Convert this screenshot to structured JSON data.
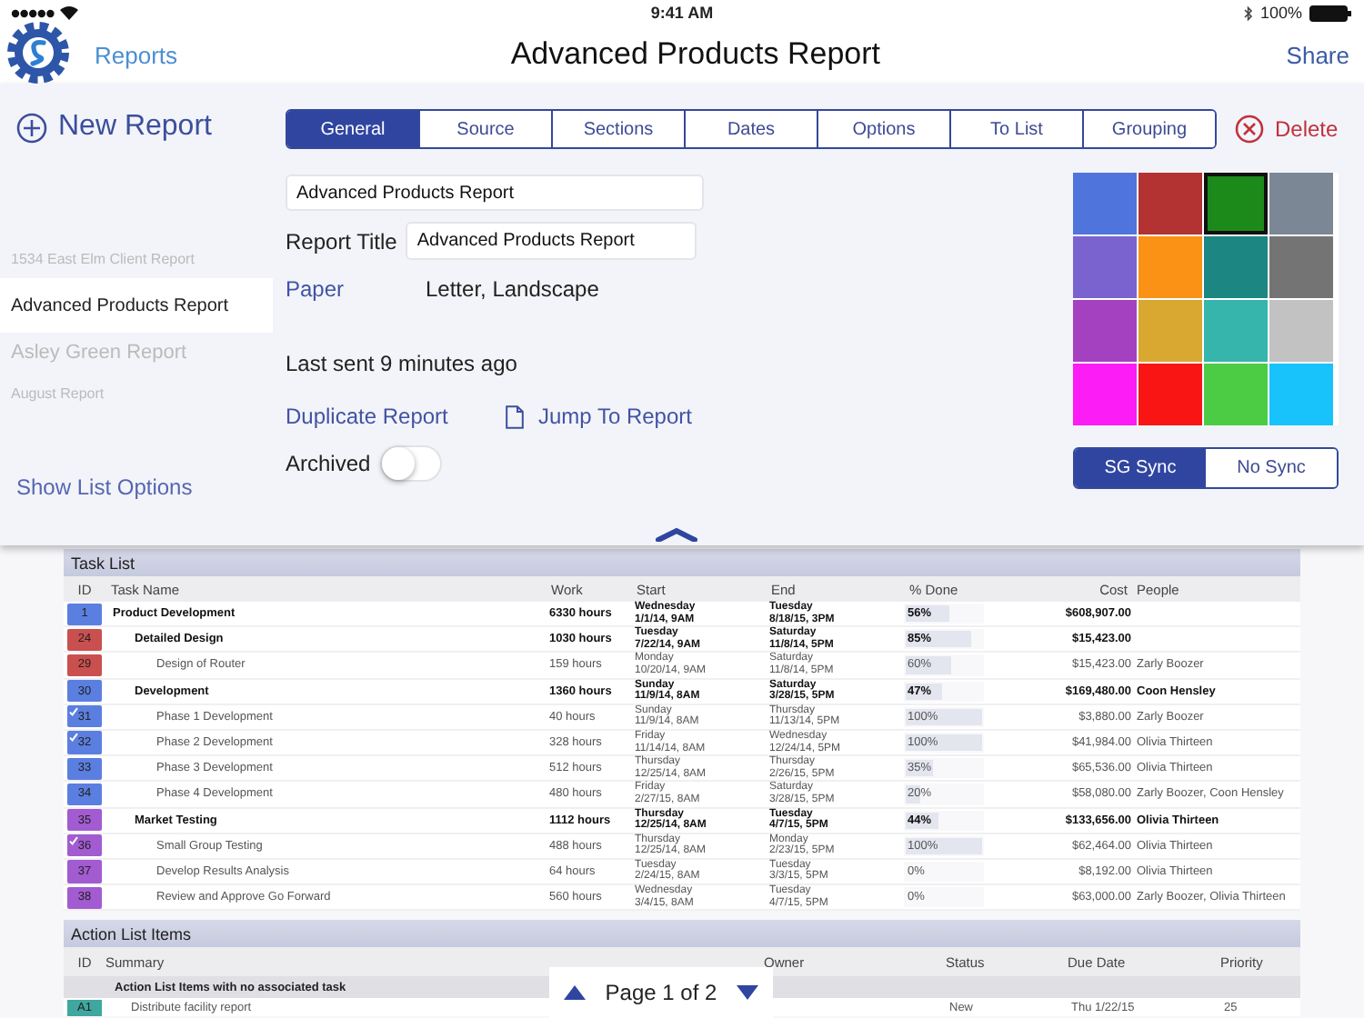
{
  "status_bar": {
    "time": "9:41 AM",
    "battery": "100%"
  },
  "nav": {
    "back": "Reports",
    "title": "Advanced Products Report",
    "action": "Share"
  },
  "new_report": "New Report",
  "report_list": [
    {
      "name": "1534 East Elm Client Report",
      "selected": false
    },
    {
      "name": "Advanced Products Report",
      "selected": true
    },
    {
      "name": "Asley Green Report",
      "selected": false
    },
    {
      "name": "August Report",
      "selected": false
    }
  ],
  "show_list_options": "Show List Options",
  "tabs": [
    {
      "label": "General",
      "selected": true
    },
    {
      "label": "Source",
      "selected": false
    },
    {
      "label": "Sections",
      "selected": false
    },
    {
      "label": "Dates",
      "selected": false
    },
    {
      "label": "Options",
      "selected": false
    },
    {
      "label": "To List",
      "selected": false
    },
    {
      "label": "Grouping",
      "selected": false
    }
  ],
  "delete": "Delete",
  "form": {
    "name_field": {
      "value": "Advanced Products Report"
    },
    "report_title": {
      "label": "Report Title",
      "value": "Advanced Products Report"
    },
    "paper": {
      "label": "Paper",
      "value": "Letter, Landscape"
    },
    "last_sent": "Last sent 9 minutes ago",
    "duplicate": "Duplicate Report",
    "jump": "Jump To Report",
    "archived": {
      "label": "Archived",
      "on": false
    }
  },
  "colors": [
    {
      "color": "#4f74dc",
      "selected": false
    },
    {
      "color": "#b33232",
      "selected": false
    },
    {
      "color": "#1b8a1b",
      "selected": true
    },
    {
      "color": "#7b8795",
      "selected": false
    },
    {
      "color": "#7a63cf",
      "selected": false
    },
    {
      "color": "#fb9115",
      "selected": false
    },
    {
      "color": "#1c8683",
      "selected": false
    },
    {
      "color": "#747474",
      "selected": false
    },
    {
      "color": "#a441c0",
      "selected": false
    },
    {
      "color": "#d9a831",
      "selected": false
    },
    {
      "color": "#36b5ad",
      "selected": false
    },
    {
      "color": "#c2c2c2",
      "selected": false
    },
    {
      "color": "#fb1cf6",
      "selected": false
    },
    {
      "color": "#fa1515",
      "selected": false
    },
    {
      "color": "#4ccc44",
      "selected": false
    },
    {
      "color": "#18c2fb",
      "selected": false
    }
  ],
  "sync": [
    {
      "label": "SG Sync",
      "selected": true
    },
    {
      "label": "No Sync",
      "selected": false
    }
  ],
  "task_list": {
    "title": "Task List",
    "columns": [
      "ID",
      "Task Name",
      "Work",
      "Start",
      "End",
      "% Done",
      "Cost",
      "People"
    ],
    "rows": [
      {
        "id": "1",
        "color": "#5b7fe0",
        "checked": false,
        "name": "Product Development",
        "work": "6330 hours",
        "start_day": "Wednesday",
        "start_time": "1/1/14, 9AM",
        "end_day": "Tuesday",
        "end_time": "8/18/15, 3PM",
        "done": "56%",
        "level": 0.56,
        "cost": "$608,907.00",
        "children": [
          {
            "id": "24",
            "color": "#c9504f",
            "checked": false,
            "name": "Detailed Design",
            "work": "1030 hours",
            "start_day": "Tuesday",
            "start_time": "7/22/14, 9AM",
            "end_day": "Saturday",
            "end_time": "11/8/14, 5PM",
            "done": "85%",
            "level": 0.85,
            "cost": "$15,423.00",
            "children": [
              {
                "id": "29",
                "color": "#c9504f",
                "checked": false,
                "name": "Design of Router",
                "work": "159 hours",
                "start_day": "Monday",
                "start_time": "10/20/14, 9AM",
                "end_day": "Saturday",
                "end_time": "11/8/14, 5PM",
                "done": "60%",
                "level": 0.6,
                "cost": "$15,423.00",
                "people": "Zarly Boozer"
              }
            ]
          },
          {
            "id": "30",
            "color": "#5b7fe0",
            "checked": false,
            "name": "Development",
            "work": "1360 hours",
            "start_day": "Sunday",
            "start_time": "11/9/14, 8AM",
            "end_day": "Saturday",
            "end_time": "3/28/15, 5PM",
            "done": "47%",
            "level": 0.47,
            "cost": "$169,480.00",
            "people": "Coon Hensley",
            "children": [
              {
                "id": "31",
                "color": "#5b7fe0",
                "checked": true,
                "name": "Phase 1 Development",
                "work": "40 hours",
                "start_day": "Sunday",
                "start_time": "11/9/14, 8AM",
                "end_day": "Thursday",
                "end_time": "11/13/14, 5PM",
                "done": "100%",
                "level": 1,
                "cost": "$3,880.00",
                "people": "Zarly Boozer"
              },
              {
                "id": "32",
                "color": "#5b7fe0",
                "checked": true,
                "name": "Phase 2 Development",
                "work": "328 hours",
                "start_day": "Friday",
                "start_time": "11/14/14, 8AM",
                "end_day": "Wednesday",
                "end_time": "12/24/14, 5PM",
                "done": "100%",
                "level": 1,
                "cost": "$41,984.00",
                "people": "Olivia Thirteen"
              },
              {
                "id": "33",
                "color": "#5b7fe0",
                "checked": false,
                "name": "Phase 3 Development",
                "work": "512 hours",
                "start_day": "Thursday",
                "start_time": "12/25/14, 8AM",
                "end_day": "Thursday",
                "end_time": "2/26/15, 5PM",
                "done": "35%",
                "level": 0.35,
                "cost": "$65,536.00",
                "people": "Olivia Thirteen"
              },
              {
                "id": "34",
                "color": "#5b7fe0",
                "checked": false,
                "name": "Phase 4 Development",
                "work": "480 hours",
                "start_day": "Friday",
                "start_time": "2/27/15, 8AM",
                "end_day": "Saturday",
                "end_time": "3/28/15, 5PM",
                "done": "20%",
                "level": 0.2,
                "cost": "$58,080.00",
                "people": "Zarly Boozer, Coon Hensley"
              }
            ]
          },
          {
            "id": "35",
            "color": "#a25bd0",
            "checked": false,
            "name": "Market Testing",
            "work": "1112 hours",
            "start_day": "Thursday",
            "start_time": "12/25/14, 8AM",
            "end_day": "Tuesday",
            "end_time": "4/7/15, 5PM",
            "done": "44%",
            "level": 0.44,
            "cost": "$133,656.00",
            "people": "Olivia Thirteen",
            "children": [
              {
                "id": "36",
                "color": "#a25bd0",
                "checked": true,
                "name": "Small Group Testing",
                "work": "488 hours",
                "start_day": "Thursday",
                "start_time": "12/25/14, 8AM",
                "end_day": "Monday",
                "end_time": "2/23/15, 5PM",
                "done": "100%",
                "level": 1,
                "cost": "$62,464.00",
                "people": "Olivia Thirteen"
              },
              {
                "id": "37",
                "color": "#a25bd0",
                "checked": false,
                "name": "Develop Results Analysis",
                "work": "64 hours",
                "start_day": "Tuesday",
                "start_time": "2/24/15, 8AM",
                "end_day": "Tuesday",
                "end_time": "3/3/15, 5PM",
                "done": "0%",
                "level": 0,
                "cost": "$8,192.00",
                "people": "Olivia Thirteen"
              },
              {
                "id": "38",
                "color": "#a25bd0",
                "checked": false,
                "name": "Review and Approve Go Forward",
                "work": "560 hours",
                "start_day": "Wednesday",
                "start_time": "3/4/15, 8AM",
                "end_day": "Tuesday",
                "end_time": "4/7/15, 5PM",
                "done": "0%",
                "level": 0,
                "cost": "$63,000.00",
                "people": "Zarly Boozer, Olivia Thirteen"
              }
            ]
          }
        ]
      }
    ]
  },
  "action_list": {
    "title": "Action List Items",
    "columns": [
      "ID",
      "Summary",
      "Owner",
      "Status",
      "Due Date",
      "Priority"
    ],
    "groups": [
      {
        "title": "Action List Items with no associated task",
        "items": [
          {
            "id": "A1",
            "color": "#3fa79f",
            "summary": "Distribute facility report",
            "status": "New",
            "due_date": "Thu 1/22/15",
            "priority": "25"
          }
        ]
      }
    ]
  },
  "pager": {
    "label": "Page 1 of 2"
  }
}
